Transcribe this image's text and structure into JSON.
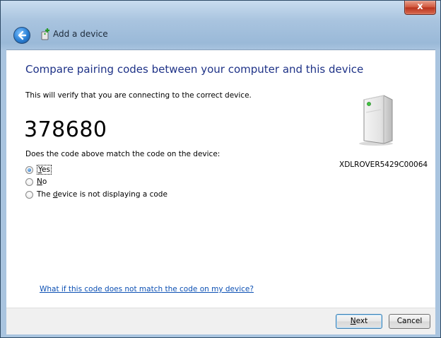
{
  "window": {
    "title": "Add a device",
    "close_label": "x"
  },
  "content": {
    "heading": "Compare pairing codes between your computer and this device",
    "subtext": "This will verify that you are connecting to the correct device.",
    "code": "378680",
    "question": "Does the code above match the code on the device:",
    "options": [
      {
        "pre": "",
        "accel": "Y",
        "post": "es",
        "checked": true
      },
      {
        "pre": "",
        "accel": "N",
        "post": "o",
        "checked": false
      },
      {
        "pre": "The ",
        "accel": "d",
        "post": "evice is not displaying a code",
        "checked": false
      }
    ],
    "device_name": "XDLROVER5429C00064",
    "help_link": "What if this code does not match the code on my device?"
  },
  "footer": {
    "next": {
      "accel": "N",
      "rest": "ext"
    },
    "cancel": "Cancel"
  },
  "icons": {
    "back": "back-arrow-icon",
    "title": "bluetooth-device-icon",
    "device": "device-tower-icon"
  }
}
